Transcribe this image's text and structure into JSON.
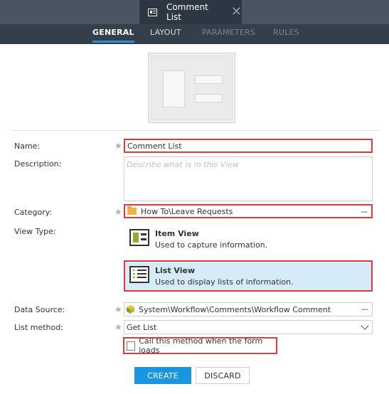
{
  "window": {
    "tab_title": "Comment List",
    "close_glyph": "✕"
  },
  "nav": {
    "tabs": [
      "GENERAL",
      "LAYOUT",
      "PARAMETERS",
      "RULES"
    ],
    "active": "GENERAL"
  },
  "form": {
    "name": {
      "label": "Name:",
      "value": "Comment List"
    },
    "description": {
      "label": "Description:",
      "placeholder": "Describe what is in this View"
    },
    "category": {
      "label": "Category:",
      "value": "How To\\Leave Requests",
      "picker": "---"
    },
    "view_type": {
      "label": "View Type:",
      "options": [
        {
          "title": "Item View",
          "desc": "Used to capture information.",
          "selected": false
        },
        {
          "title": "List View",
          "desc": "Used to display lists of information.",
          "selected": true
        }
      ]
    },
    "data_source": {
      "label": "Data Source:",
      "value": "System\\Workflow\\Comments\\Workflow Comment",
      "picker": "---"
    },
    "list_method": {
      "label": "List method:",
      "value": "Get List"
    },
    "call_on_load": {
      "label": "Call this method when the form loads",
      "checked": false
    }
  },
  "buttons": {
    "create": "CREATE",
    "discard": "DISCARD"
  },
  "colors": {
    "accent": "#1b95e0",
    "highlight": "#e03a3e",
    "selected_bg": "#d6ebf8",
    "titlebar": "#4a5560",
    "navbar": "#343f49"
  }
}
